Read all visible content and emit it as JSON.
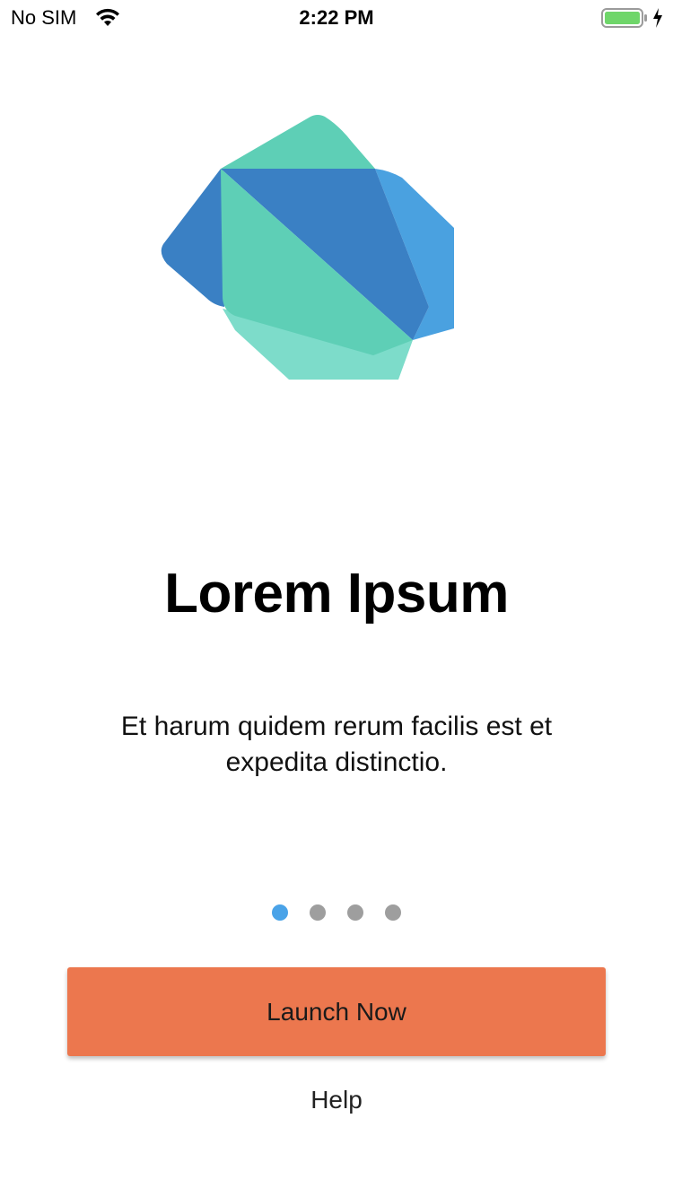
{
  "status_bar": {
    "carrier": "No SIM",
    "time": "2:22 PM",
    "battery_color": "#6fd66a"
  },
  "logo": {
    "icon": "dart-logo",
    "colors": {
      "teal": "#5ecfb6",
      "teal_light": "#7ddcca",
      "blue": "#3a80c4",
      "blue_light": "#4aa1e0"
    }
  },
  "onboarding": {
    "title": "Lorem Ipsum",
    "description": "Et harum quidem rerum facilis est et expedita distinctio.",
    "pages": 4,
    "current_page": 1,
    "active_dot_color": "#4aa3e8",
    "inactive_dot_color": "#9e9e9e"
  },
  "actions": {
    "launch_label": "Launch Now",
    "launch_color": "#ec774e",
    "help_label": "Help"
  }
}
